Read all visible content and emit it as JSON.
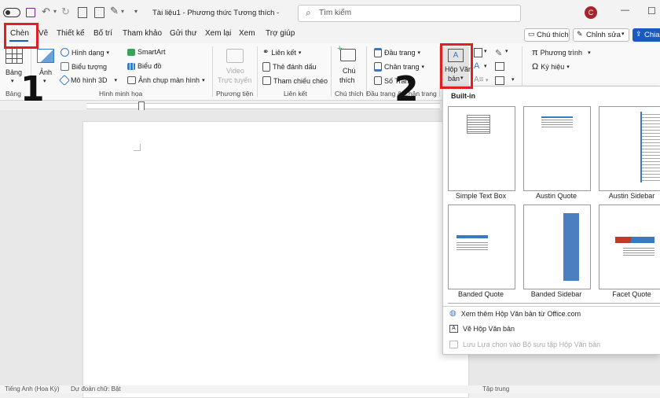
{
  "title_bar": {
    "doc_title": "Tài liệu1 - Phương thức Tương thích  -",
    "search_placeholder": "Tìm kiếm",
    "avatar_letter": "C",
    "dropdown_glyph": "▾",
    "minimize": "—",
    "restore": "☐"
  },
  "tabs": [
    "Chèn",
    "Vẽ",
    "Thiết kế",
    "Bố trí",
    "Tham khảo",
    "Gửi thư",
    "Xem lại",
    "Xem",
    "Trợ giúp"
  ],
  "tab_actions": {
    "comments": "Chú thích",
    "edit": "Chỉnh sửa",
    "share": "Chia"
  },
  "ribbon": {
    "tables": {
      "label": "Bảng",
      "group": "Bảng"
    },
    "illustrations": {
      "image": "Ảnh",
      "shapes": "Hình dạng",
      "icons": "Biểu tượng",
      "model3d": "Mô hình 3D",
      "smartart": "SmartArt",
      "chart": "Biểu đồ",
      "screenshot": "Ảnh chụp màn hình",
      "group": "Hình minh họa"
    },
    "media": {
      "video_line1": "Video",
      "video_line2": "Trực tuyến",
      "group": "Phương tiện"
    },
    "links": {
      "link": "Liên kết",
      "bookmark": "Thẻ đánh dấu",
      "crossref": "Tham chiếu chéo",
      "group": "Liên kết"
    },
    "comments": {
      "line1": "Chú",
      "line2": "thích",
      "group": "Chú thích"
    },
    "header_footer": {
      "header": "Đầu trang",
      "footer": "Chân trang",
      "page_number": "Số Trang",
      "group": "Đầu trang & Chân trang"
    },
    "text": {
      "textbox_line1": "Hộp Văn",
      "textbox_line2": "bản"
    },
    "symbols": {
      "equation": "Phương trình",
      "symbol": "Ký hiệu"
    }
  },
  "gallery": {
    "header": "Built-in",
    "items": [
      "Simple Text Box",
      "Austin Quote",
      "Austin Sidebar",
      "Banded Quote",
      "Banded Sidebar",
      "Facet Quote"
    ],
    "menu": {
      "more": "Xem thêm Hộp Văn bản từ Office.com",
      "draw": "Vẽ Hộp Văn bản",
      "save": "Lưu Lựa chọn vào Bộ sưu tập Hộp Văn bản"
    }
  },
  "annotations": {
    "step1": "1",
    "step2": "2"
  },
  "status_bar": {
    "language": "Tiếng Anh (Hoa Kỳ)",
    "predict": "Dự đoán chữ: Bật",
    "focus": "Tập trung"
  },
  "colors": {
    "accent": "#185abd",
    "annotation": "#e02020",
    "avatar": "#a4262c"
  }
}
